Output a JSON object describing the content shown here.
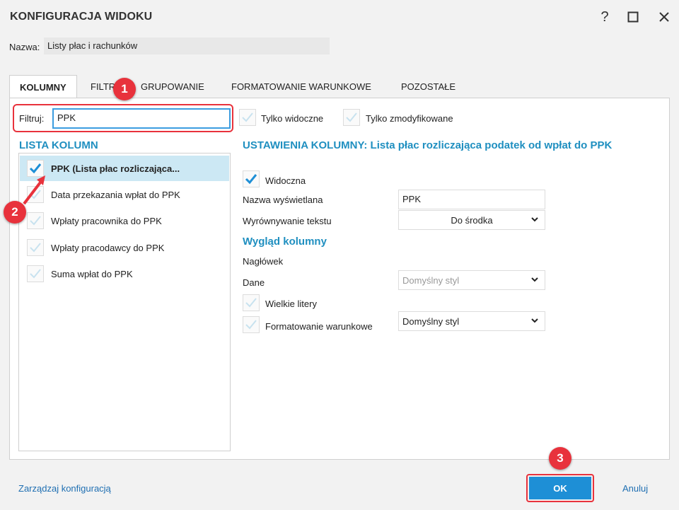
{
  "window": {
    "title": "KONFIGURACJA WIDOKU",
    "help": "?",
    "maximize": "☐",
    "close": "✕"
  },
  "name": {
    "label": "Nazwa:",
    "value": "Listy płac i rachunków"
  },
  "tabs": [
    {
      "label": "KOLUMNY"
    },
    {
      "label": "FILTR"
    },
    {
      "label": "GRUPOWANIE"
    },
    {
      "label": "FORMATOWANIE WARUNKOWE"
    },
    {
      "label": "POZOSTAŁE"
    }
  ],
  "filter": {
    "label": "Filtruj:",
    "value": "PPK",
    "only_visible": "Tylko widoczne",
    "only_modified": "Tylko zmodyfikowane"
  },
  "column_list": {
    "title": "LISTA KOLUMN",
    "items": [
      {
        "label": "PPK (Lista płac rozliczająca...",
        "checked": true,
        "selected": true
      },
      {
        "label": "Data przekazania wpłat do PPK",
        "checked": false,
        "selected": false
      },
      {
        "label": "Wpłaty pracownika do PPK",
        "checked": false,
        "selected": false
      },
      {
        "label": "Wpłaty pracodawcy do PPK",
        "checked": false,
        "selected": false
      },
      {
        "label": "Suma wpłat do PPK",
        "checked": false,
        "selected": false
      }
    ]
  },
  "settings": {
    "title": "USTAWIENIA KOLUMNY: Lista płac rozliczająca podatek od wpłat do PPK",
    "visible_label": "Widoczna",
    "display_name_label": "Nazwa wyświetlana",
    "display_name_value": "PPK",
    "alignment_label": "Wyrównywanie tekstu",
    "alignment_value": "Do środka",
    "appearance_title": "Wygląd kolumny",
    "header_label": "Nagłówek",
    "header_value": "Domyślny styl",
    "data_label": "Dane",
    "data_value": "Domyślny styl",
    "uppercase_label": "Wielkie litery",
    "conditional_label": "Formatowanie warunkowe"
  },
  "footer": {
    "manage_link": "Zarządzaj konfiguracją",
    "ok": "OK",
    "cancel": "Anuluj"
  },
  "badges": [
    "1",
    "2",
    "3"
  ],
  "colors": {
    "accent": "#1f8fc0",
    "primary_button": "#1e8fd6",
    "highlight": "#e8323c",
    "selected_row": "#cce8f4"
  }
}
